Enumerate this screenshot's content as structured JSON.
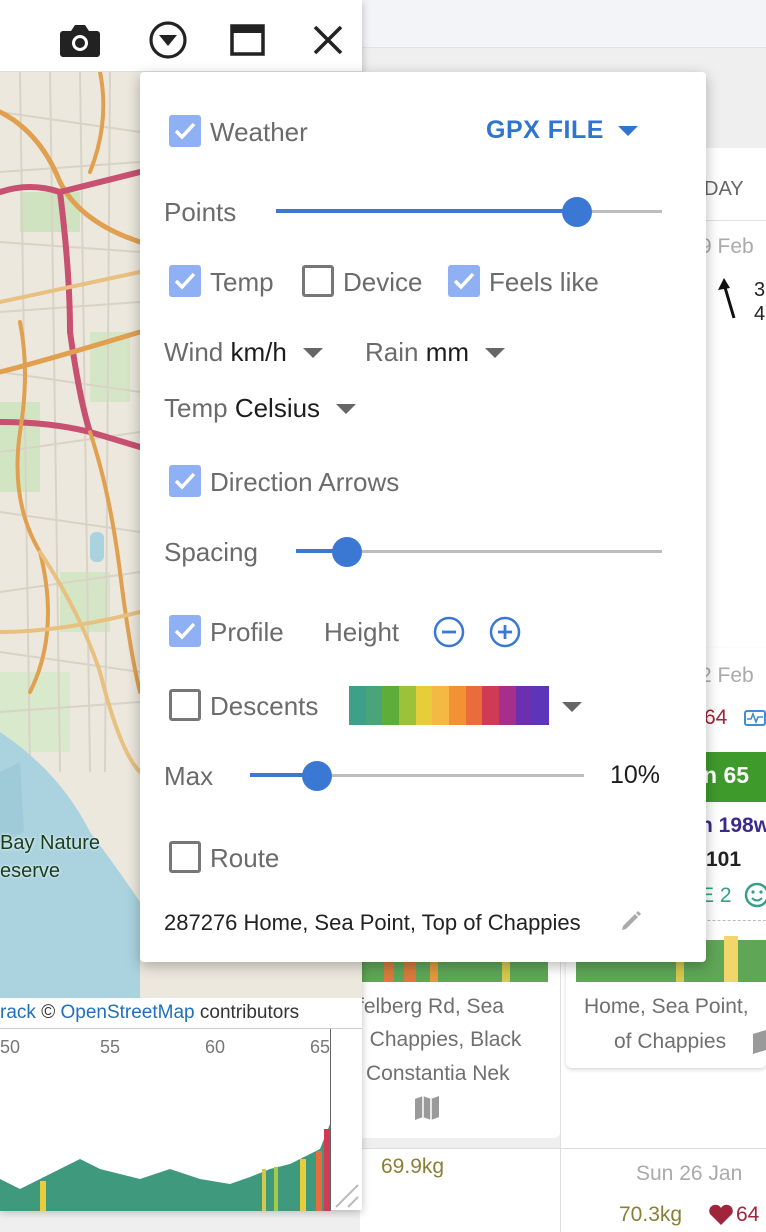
{
  "window_icons": [
    "camera-icon",
    "download-circle-icon",
    "maximize-icon",
    "close-icon"
  ],
  "popup": {
    "weather_label": "Weather",
    "weather_checked": true,
    "source_label": "GPX FILE",
    "points_label": "Points",
    "points_level": 0.78,
    "temp_check_label": "Temp",
    "temp_checked": true,
    "device_label": "Device",
    "device_checked": false,
    "feels_like_label": "Feels like",
    "feels_like_checked": true,
    "wind_label": "Wind",
    "wind_unit": "km/h",
    "rain_label": "Rain",
    "rain_unit": "mm",
    "temp_unit_label": "Temp",
    "temp_unit": "Celsius",
    "direction_arrows_label": "Direction Arrows",
    "direction_arrows_checked": true,
    "spacing_label": "Spacing",
    "spacing_level": 0.14,
    "profile_label": "Profile",
    "profile_checked": true,
    "height_label": "Height",
    "descents_label": "Descents",
    "descents_checked": false,
    "descent_palette": [
      "#3fa08a",
      "#4aa47a",
      "#5eac3a",
      "#9cc23a",
      "#e8cd3b",
      "#f4b942",
      "#f19335",
      "#ea6b3c",
      "#d03a55",
      "#a52f8a",
      "#6c2fb0",
      "#5d35b8"
    ],
    "max_label": "Max",
    "max_value": "10%",
    "max_level": 0.2,
    "route_label": "Route",
    "route_checked": false,
    "route_name": "287276 Home, Sea Point, Top of Chappies"
  },
  "map": {
    "place_line1": "Bay Nature",
    "place_line2": "eserve",
    "attrib_prefix": "rack ",
    "attrib_copy": "©",
    "attrib_link": "OpenStreetMap",
    "attrib_suffix": "contributors"
  },
  "profile_ticks": [
    "50",
    "55",
    "60",
    "65"
  ],
  "calendar": {
    "day_header": "DAY",
    "date1": "9 Feb",
    "arrow_val1": "3",
    "arrow_val2": "4",
    "date2": "2 Feb",
    "hr_partial": "64",
    "badge_partial": "n 65",
    "watts_partial": "n 198w",
    "num_101": "101",
    "emote_partial": "E 2",
    "card1_line1": "felberg Rd, Sea",
    "card1_line2": ", Chappies, Black",
    "card1_line3": "Constantia Nek",
    "card2_line1": "Home, Sea Point,",
    "card2_line2": "of Chappies",
    "weight1": "69.9kg",
    "date3": "Sun 26 Jan",
    "weight2": "70.3kg",
    "hr2": "64"
  },
  "colors": {
    "accent": "#3a78d4",
    "checkbox_on": "#8fb0f2",
    "gpx_link": "#2f74d0"
  }
}
